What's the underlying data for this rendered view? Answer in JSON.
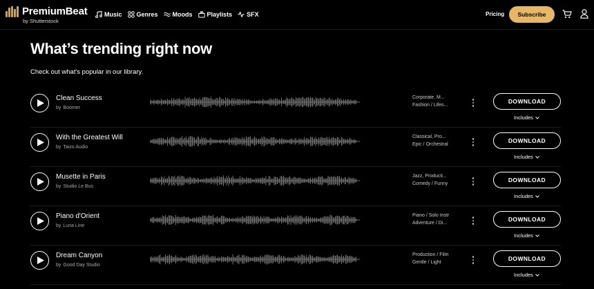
{
  "header": {
    "logo_name": "PremiumBeat",
    "logo_sub": "by Shutterstock",
    "nav": [
      {
        "label": "Music",
        "icon": "music-note-icon"
      },
      {
        "label": "Genres",
        "icon": "genres-grid-icon"
      },
      {
        "label": "Moods",
        "icon": "moods-waves-icon"
      },
      {
        "label": "Playlists",
        "icon": "playlists-icon"
      },
      {
        "label": "SFX",
        "icon": "sfx-pulse-icon"
      }
    ],
    "pricing": "Pricing",
    "subscribe": "Subscribe",
    "colors": {
      "accent": "#e6b865",
      "logo": "#c9a45c",
      "background": "#000000"
    }
  },
  "hero": {
    "title": "What’s trending right now",
    "subtitle": "Check out what's popular in our library."
  },
  "track_labels": {
    "by": "by",
    "download": "DOWNLOAD",
    "includes": "Includes"
  },
  "tracks": [
    {
      "title": "Clean Success",
      "artist": "Boomer",
      "tags": [
        "Corporate, M...",
        "Fashion / Lifes..."
      ]
    },
    {
      "title": "With the Greatest Will",
      "artist": "Taizo Audio",
      "tags": [
        "Classical, Pro...",
        "Epic / Orchestral"
      ]
    },
    {
      "title": "Musette in Paris",
      "artist": "Studio Le Bus",
      "tags": [
        "Jazz, Producti...",
        "Comedy / Funny"
      ]
    },
    {
      "title": "Piano d'Orient",
      "artist": "Luna Line",
      "tags": [
        "Piano / Solo Instr",
        "Adventure / Di..."
      ]
    },
    {
      "title": "Dream Canyon",
      "artist": "Good Day Studio",
      "tags": [
        "Production / Film",
        "Gentle / Light"
      ]
    }
  ]
}
